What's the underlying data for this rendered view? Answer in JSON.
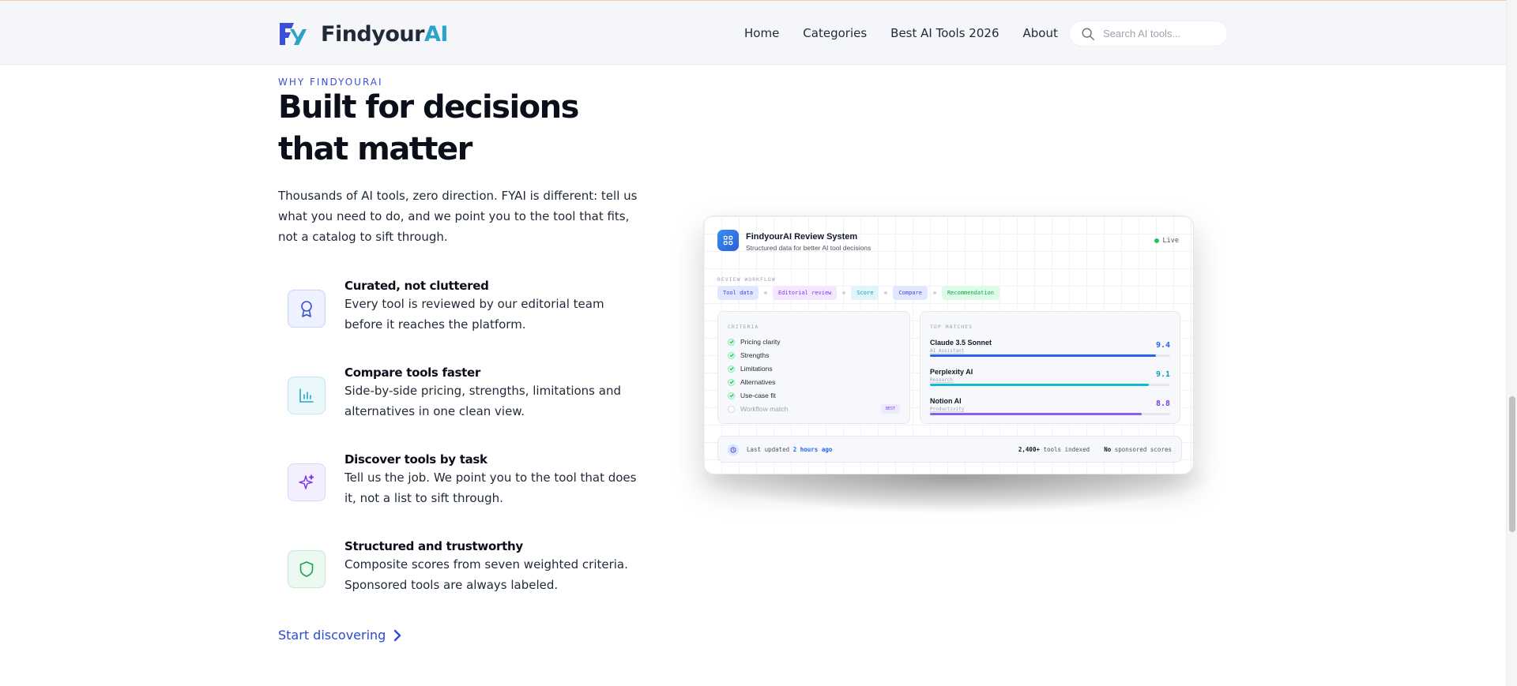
{
  "header": {
    "brand_main": "Findyour",
    "brand_accent": "AI",
    "nav": [
      "Home",
      "Categories",
      "Best AI Tools 2026",
      "About"
    ],
    "search_placeholder": "Search AI tools..."
  },
  "section": {
    "eyebrow": "WHY FINDYOURAI",
    "title_line1": "Built for decisions",
    "title_line2": "that matter",
    "intro": "Thousands of AI tools, zero direction. FYAI is different: tell us what you need to do, and we point you to the tool that fits, not a catalog to sift through.",
    "features": [
      {
        "title": "Curated, not cluttered",
        "desc": "Every tool is reviewed by our editorial team before it reaches the platform.",
        "icon": "award-ribbon-icon"
      },
      {
        "title": "Compare tools faster",
        "desc": "Side-by-side pricing, strengths, limitations and alternatives in one clean view.",
        "icon": "bar-chart-icon"
      },
      {
        "title": "Discover tools by task",
        "desc": "Tell us the job. We point you to the tool that does it, not a list to sift through.",
        "icon": "sparkle-icon"
      },
      {
        "title": "Structured and trustworthy",
        "desc": "Composite scores from seven weighted criteria. Sponsored tools are always labeled.",
        "icon": "shield-icon"
      }
    ],
    "cta": "Start discovering"
  },
  "card": {
    "title": "FindyourAI Review System",
    "subtitle": "Structured data for better AI tool decisions",
    "status": "Live",
    "workflow_label": "REVIEW WORKFLOW",
    "steps": [
      "Tool data",
      "Editorial review",
      "Score",
      "Compare",
      "Recommendation"
    ],
    "criteria_label": "CRITERIA",
    "criteria": [
      {
        "label": "Pricing clarity",
        "checked": true
      },
      {
        "label": "Strengths",
        "checked": true
      },
      {
        "label": "Limitations",
        "checked": true
      },
      {
        "label": "Alternatives",
        "checked": true
      },
      {
        "label": "Use-case fit",
        "checked": true
      },
      {
        "label": "Workflow match",
        "checked": false
      }
    ],
    "criteria_pill": "BEST",
    "matches_label": "TOP MATCHES",
    "matches": [
      {
        "name": "Claude 3.5 Sonnet",
        "category": "AI Assistant",
        "score": "9.4",
        "fraction": 0.94
      },
      {
        "name": "Perplexity AI",
        "category": "Research",
        "score": "9.1",
        "fraction": 0.91
      },
      {
        "name": "Notion AI",
        "category": "Productivity",
        "score": "8.8",
        "fraction": 0.88
      }
    ],
    "updated_prefix": "Last updated",
    "updated_value": "2 hours ago",
    "tools_count": "2,400+",
    "tools_suffix": "tools indexed",
    "sponsored_prefix": "No",
    "sponsored_suffix": "sponsored scores"
  },
  "colors": {
    "accent": "#2b49d6",
    "brand_ai": "#2aa3c9",
    "score_blue": "#2563eb",
    "score_teal": "#0e9fb8",
    "score_purple": "#7c3aed"
  }
}
